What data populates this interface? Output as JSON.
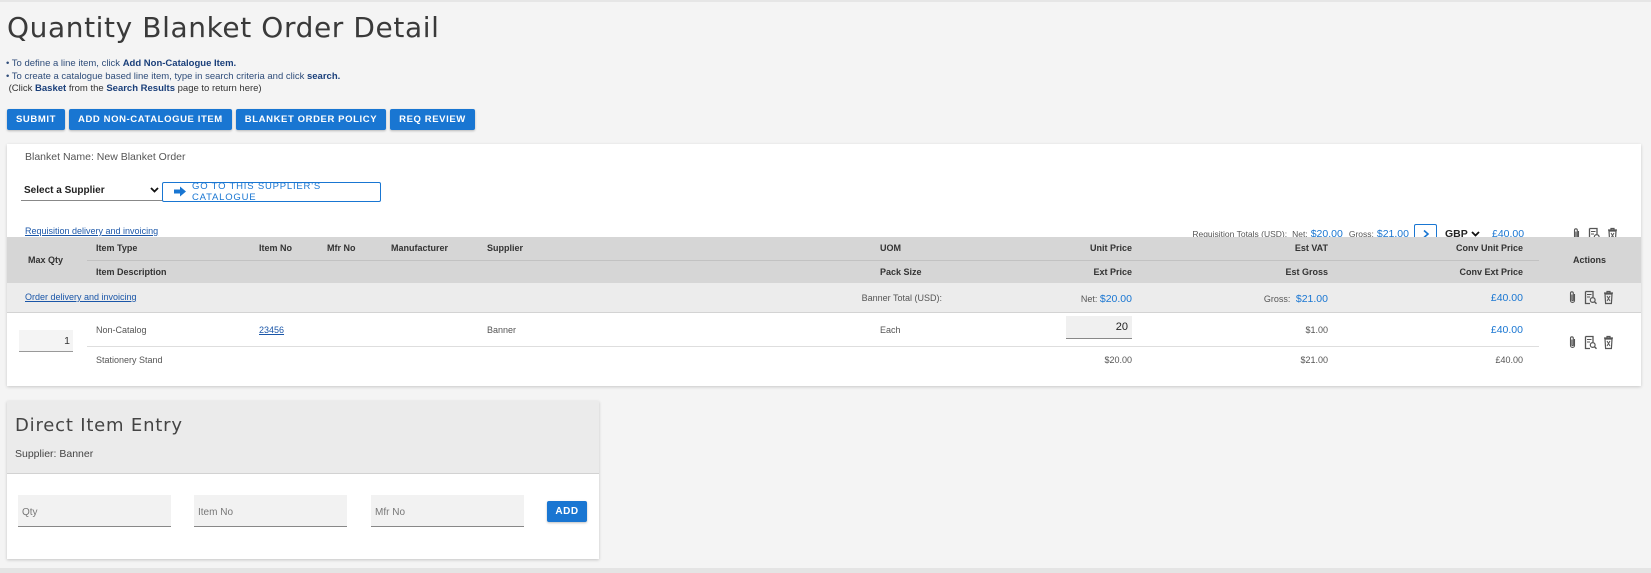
{
  "page": {
    "title": "Quantity Blanket Order Detail",
    "instructions": {
      "line1_prefix": "• To define a line item, click ",
      "line1_bold": "Add Non-Catalogue Item.",
      "line2_prefix": "• To create a catalogue based line item, type in search criteria and click ",
      "line2_bold": "search.",
      "line3_a": "(Click ",
      "line3_bold1": "Basket",
      "line3_b": " from the ",
      "line3_bold2": "Search Results",
      "line3_c": " page to return here)"
    }
  },
  "toolbar": {
    "submit": "SUBMIT",
    "add_non_catalogue": "ADD NON-CATALOGUE ITEM",
    "blanket_policy": "BLANKET ORDER POLICY",
    "req_review": "REQ REVIEW"
  },
  "blanket": {
    "name_label": "Blanket Name:",
    "name_value": "New Blanket Order",
    "supplier_select": "Select a Supplier",
    "goto_catalogue": "GO TO THIS SUPPLIER'S CATALOGUE",
    "req_link": "Requisition delivery and invoicing",
    "totals": {
      "label": "Requisition Totals (USD):",
      "net_label": "Net:",
      "net_value": "$20.00",
      "gross_label": "Gross:",
      "gross_value": "$21.00",
      "currency": "GBP",
      "converted": "£40.00"
    }
  },
  "grid": {
    "headers": {
      "max_qty": "Max Qty",
      "item_type": "Item Type",
      "item_no": "Item No",
      "mfr_no": "Mfr No",
      "manufacturer": "Manufacturer",
      "supplier": "Supplier",
      "uom": "UOM",
      "unit_price": "Unit Price",
      "est_vat": "Est VAT",
      "conv_unit_price": "Conv Unit Price",
      "actions": "Actions",
      "item_description": "Item Description",
      "pack_size": "Pack Size",
      "ext_price": "Ext Price",
      "est_gross": "Est Gross",
      "conv_ext_price": "Conv Ext Price"
    },
    "order_row": {
      "link": "Order delivery and invoicing",
      "total_label": "Banner Total (USD):",
      "net_label": "Net:",
      "net_value": "$20.00",
      "gross_label": "Gross:",
      "gross_value": "$21.00",
      "converted": "£40.00"
    },
    "item": {
      "qty": "1",
      "item_type": "Non-Catalog",
      "item_no": "23456",
      "supplier": "Banner",
      "uom": "Each",
      "unit_price": "20",
      "est_vat": "$1.00",
      "conv_unit_price": "£40.00",
      "description": "Stationery Stand",
      "ext_price": "$20.00",
      "est_gross": "$21.00",
      "conv_ext_price": "£40.00"
    }
  },
  "direct_entry": {
    "title": "Direct Item Entry",
    "supplier": "Supplier: Banner",
    "qty_placeholder": "Qty",
    "item_no_placeholder": "Item No",
    "mfr_no_placeholder": "Mfr No",
    "add": "ADD"
  },
  "colors": {
    "primary": "#1976d2",
    "grid_header": "#d6d6d6"
  }
}
